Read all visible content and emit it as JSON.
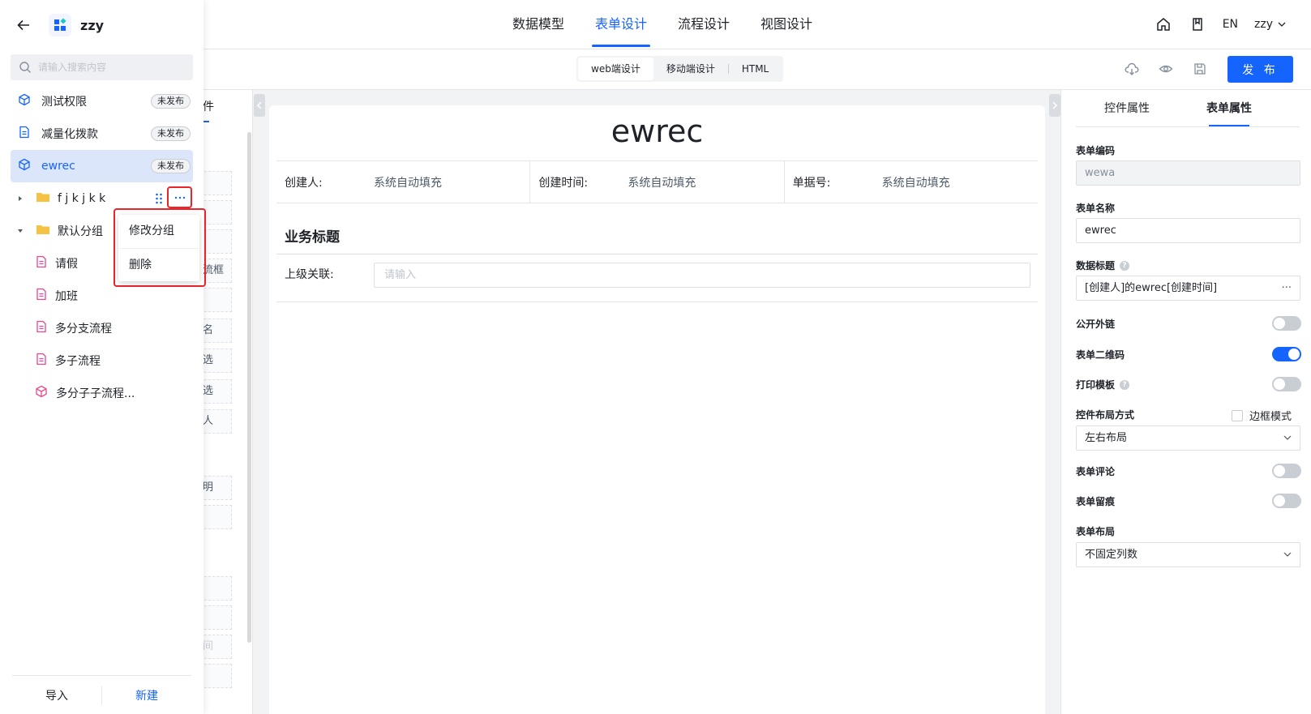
{
  "app": {
    "name": "zzy"
  },
  "topnav": {
    "tabs": [
      {
        "label": "数据模型",
        "active": false
      },
      {
        "label": "表单设计",
        "active": true
      },
      {
        "label": "流程设计",
        "active": false
      },
      {
        "label": "视图设计",
        "active": false
      }
    ],
    "lang": "EN",
    "user": "zzy"
  },
  "toolbar": {
    "modes": [
      "web端设计",
      "移动端设计",
      "HTML"
    ],
    "active_mode": "web端设计",
    "publish_label": "发 布"
  },
  "drawer": {
    "search_placeholder": "请输入搜索内容",
    "items": [
      {
        "label": "测试权限",
        "badge": "未发布",
        "icon": "cube-icon"
      },
      {
        "label": "减量化拨款",
        "badge": "未发布",
        "icon": "document-icon"
      },
      {
        "label": "ewrec",
        "badge": "未发布",
        "icon": "cube-icon",
        "active": true
      }
    ],
    "groups": [
      {
        "label": "f j k j k k",
        "expanded": false
      },
      {
        "label": "默认分组",
        "expanded": true
      }
    ],
    "children": [
      "请假",
      "加班",
      "多分支流程",
      "多子流程",
      "多分子子流程..."
    ],
    "footer": {
      "import": "导入",
      "new": "新建"
    }
  },
  "context_menu": {
    "items": [
      "修改分组",
      "删除"
    ]
  },
  "palette": {
    "tab_fragment": "件",
    "chips": [
      "流框",
      "名",
      "选",
      "选",
      "人",
      "明",
      "间"
    ]
  },
  "form": {
    "title": "ewrec",
    "system_fields": [
      {
        "label": "创建人:",
        "value": "系统自动填充"
      },
      {
        "label": "创建时间:",
        "value": "系统自动填充"
      },
      {
        "label": "单据号:",
        "value": "系统自动填充"
      }
    ],
    "section_title": "业务标题",
    "relation_label": "上级关联:",
    "relation_placeholder": "请输入"
  },
  "props": {
    "tabs": [
      "控件属性",
      "表单属性"
    ],
    "active_tab": "表单属性",
    "form_code_label": "表单编码",
    "form_code": "wewa",
    "form_name_label": "表单名称",
    "form_name": "ewrec",
    "data_title_label": "数据标题",
    "data_title": "[创建人]的ewrec[创建时间]",
    "data_title_more": "···",
    "public_link_label": "公开外链",
    "public_link": false,
    "qr_label": "表单二维码",
    "qr": true,
    "print_label": "打印模板",
    "print": false,
    "layout_label": "控件布局方式",
    "border_mode_label": "边框模式",
    "border_mode": false,
    "layout_value": "左右布局",
    "comment_label": "表单评论",
    "comment": false,
    "trace_label": "表单留痕",
    "trace": false,
    "form_layout_label": "表单布局",
    "form_layout_value": "不固定列数"
  },
  "colors": {
    "accent": "#1664ff",
    "highlight": "#e8262a",
    "pink_icon": "#e8488f",
    "folder": "#f6c244"
  }
}
